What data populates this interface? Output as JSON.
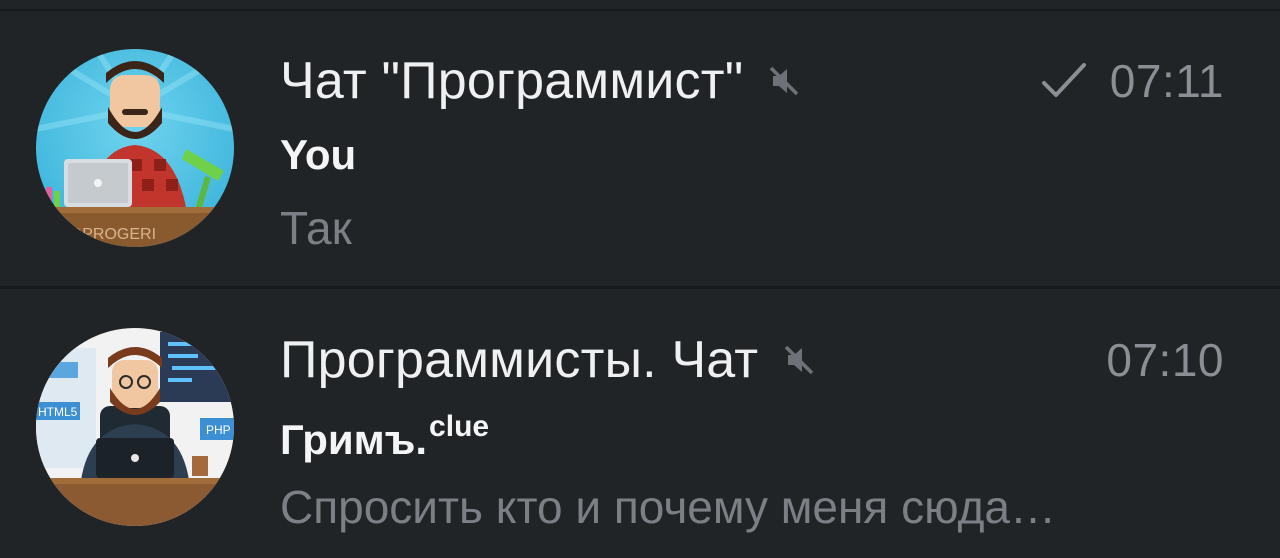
{
  "chats": [
    {
      "title": "Чат \"Программист\"",
      "muted": true,
      "read": true,
      "time": "07:11",
      "sender": "You",
      "sender_suffix": "",
      "preview": "Так",
      "avatar_caption": "@PROGERI"
    },
    {
      "title": "Программисты. Чат",
      "muted": true,
      "read": false,
      "time": "07:10",
      "sender": "Гримъ.",
      "sender_suffix": "clue",
      "preview": "Спросить кто и почему меня сюда…",
      "avatar_tags": [
        "HTML5",
        "PHP"
      ]
    }
  ],
  "colors": {
    "background": "#212427",
    "title": "#eef0f2",
    "muted_text": "#7b8086",
    "time": "#8a8f95"
  },
  "icons": {
    "mute": "speaker-muted-icon",
    "read": "check-icon"
  }
}
